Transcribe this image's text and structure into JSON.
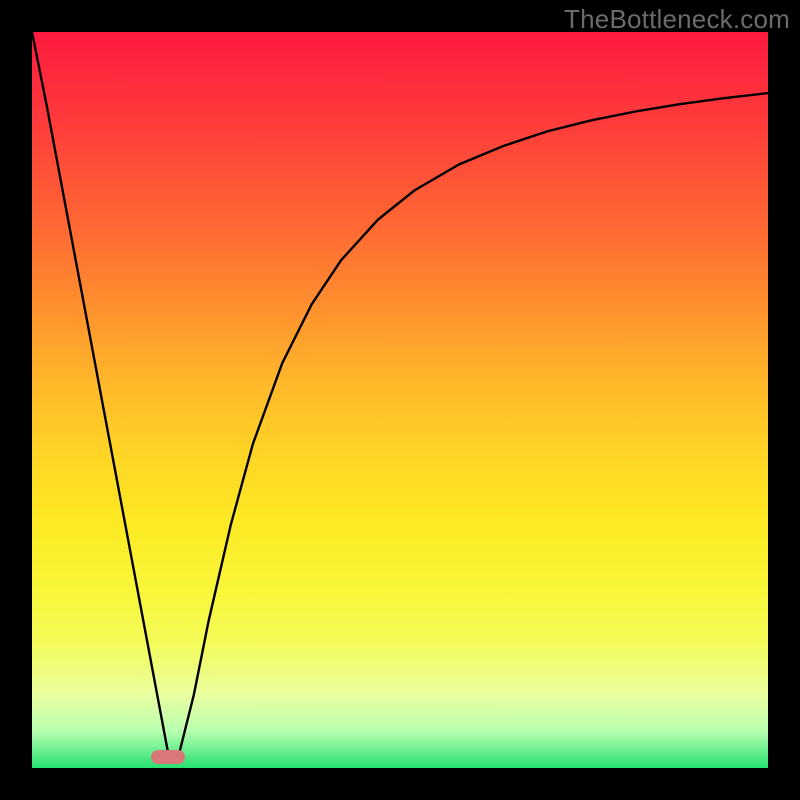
{
  "watermark": "TheBottleneck.com",
  "chart_data": {
    "type": "line",
    "title": "",
    "xlabel": "",
    "ylabel": "",
    "xlim": [
      0,
      100
    ],
    "ylim": [
      0,
      100
    ],
    "grid": false,
    "series": [
      {
        "name": "curve",
        "x": [
          0,
          2,
          5,
          8,
          11,
          14,
          17,
          18.5,
          20,
          22,
          24,
          27,
          30,
          34,
          38,
          42,
          47,
          52,
          58,
          64,
          70,
          76,
          82,
          88,
          94,
          100
        ],
        "y": [
          100,
          90,
          74,
          58,
          42,
          26,
          10,
          2,
          2,
          10,
          20,
          33,
          44,
          55,
          63,
          69,
          74.5,
          78.5,
          82,
          84.5,
          86.5,
          88,
          89.2,
          90.2,
          91,
          91.7
        ]
      }
    ],
    "marker": {
      "x": 18.5,
      "y": 1.5,
      "color": "#d9777a"
    }
  },
  "colors": {
    "gradient_top": "#ff1a3f",
    "gradient_bottom": "#25e06f",
    "frame": "#000000",
    "curve": "#000000",
    "marker": "#d9777a",
    "watermark": "#6b6b6b"
  }
}
